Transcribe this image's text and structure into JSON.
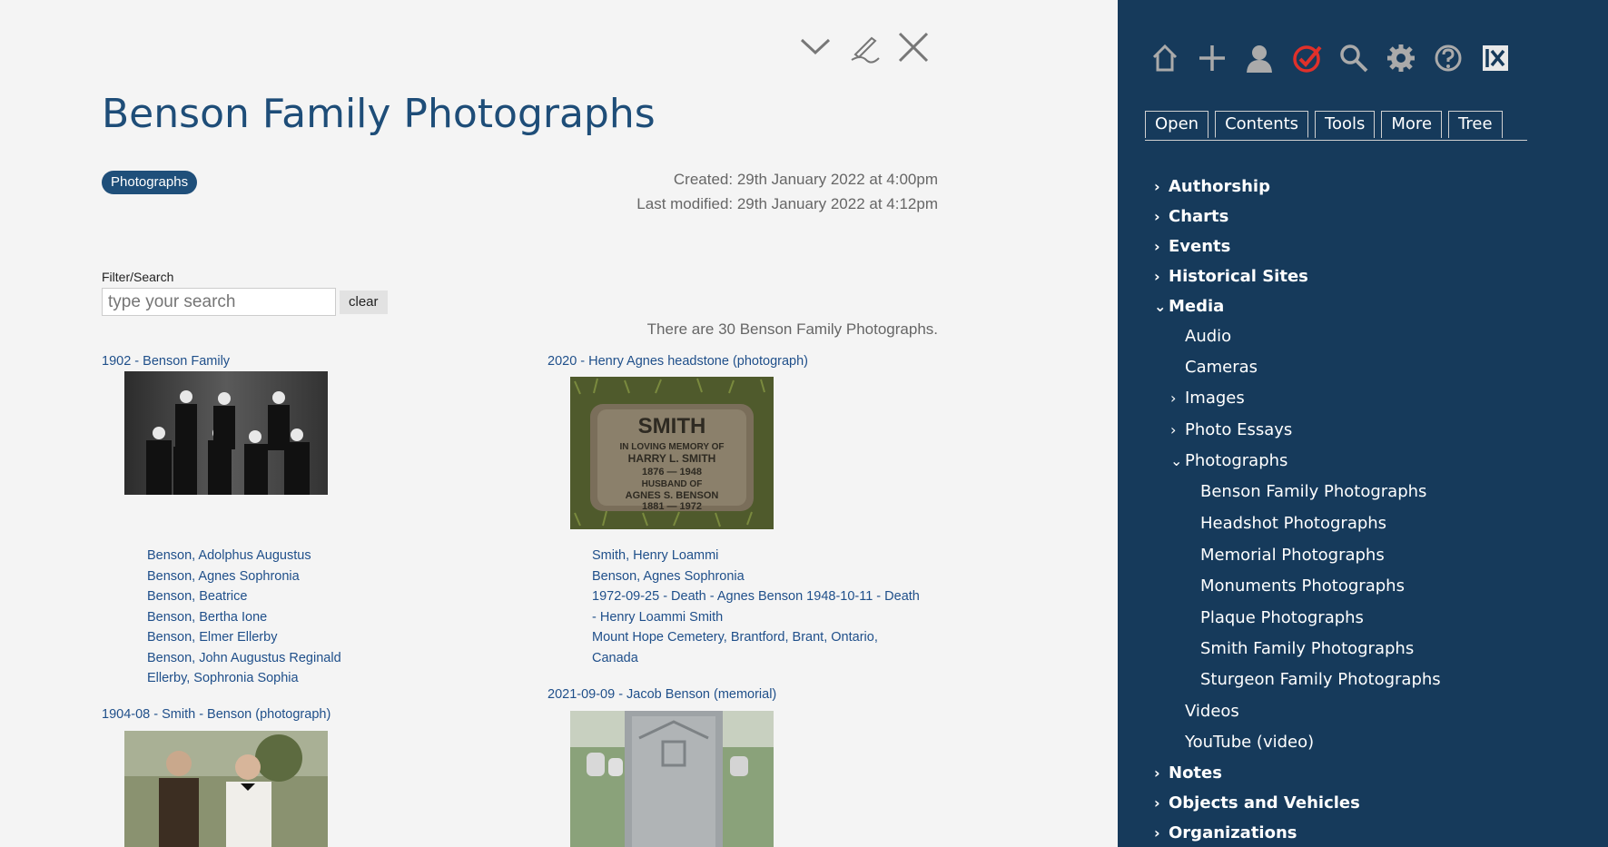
{
  "header": {
    "title": "Benson Family Photographs",
    "tag": "Photographs",
    "created": "Created: 29th January 2022 at 4:00pm",
    "modified": "Last modified: 29th January 2022 at 4:12pm"
  },
  "filter": {
    "label": "Filter/Search",
    "placeholder": "type your search",
    "clear_label": "clear"
  },
  "count_text": "There are 30 Benson Family Photographs.",
  "entries": [
    {
      "title": "1902 - Benson Family",
      "people": [
        "Benson, Adolphus Augustus",
        "Benson, Agnes Sophronia",
        "Benson, Beatrice",
        "Benson, Bertha Ione",
        "Benson, Elmer Ellerby",
        "Benson, John Augustus Reginald",
        "Ellerby, Sophronia Sophia"
      ]
    },
    {
      "title": "2020 - Henry Agnes headstone (photograph)",
      "people": [
        "Smith, Henry Loammi",
        "Benson, Agnes Sophronia",
        "1972-09-25 - Death - Agnes Benson 1948-10-11 - Death",
        "- Henry Loammi Smith",
        "Mount Hope Cemetery, Brantford, Brant, Ontario,",
        "Canada"
      ],
      "headstone_text": [
        "SMITH",
        "IN LOVING MEMORY OF",
        "HARRY L. SMITH",
        "1876 — 1948",
        "HUSBAND OF",
        "AGNES S. BENSON",
        "1881 — 1972"
      ]
    },
    {
      "title": "1904-08 - Smith - Benson (photograph)"
    },
    {
      "title": "2021-09-09 - Jacob Benson (memorial)"
    }
  ],
  "sidebar": {
    "toolbar": [
      "home-icon",
      "plus-icon",
      "user-icon",
      "check-circle-icon",
      "search-icon",
      "gear-icon",
      "help-icon",
      "close-box-icon"
    ],
    "accent": "#e0302a",
    "tabs": [
      "Open",
      "Contents",
      "Tools",
      "More",
      "Tree"
    ],
    "active_tab": "Contents",
    "tree": [
      {
        "label": "Authorship",
        "chev": "›"
      },
      {
        "label": "Charts",
        "chev": "›"
      },
      {
        "label": "Events",
        "chev": "›"
      },
      {
        "label": "Historical Sites",
        "chev": "›"
      },
      {
        "label": "Media",
        "chev": "⌄"
      },
      {
        "label": "Audio",
        "chev": ""
      },
      {
        "label": "Cameras",
        "chev": ""
      },
      {
        "label": "Images",
        "chev": "›"
      },
      {
        "label": "Photo Essays",
        "chev": "›"
      },
      {
        "label": "Photographs",
        "chev": "⌄"
      },
      {
        "label": "Benson Family Photographs",
        "chev": ""
      },
      {
        "label": "Headshot Photographs",
        "chev": ""
      },
      {
        "label": "Memorial Photographs",
        "chev": ""
      },
      {
        "label": "Monuments Photographs",
        "chev": ""
      },
      {
        "label": "Plaque Photographs",
        "chev": ""
      },
      {
        "label": "Smith Family Photographs",
        "chev": ""
      },
      {
        "label": "Sturgeon Family Photographs",
        "chev": ""
      },
      {
        "label": "Videos",
        "chev": ""
      },
      {
        "label": "YouTube (video)",
        "chev": ""
      },
      {
        "label": "Notes",
        "chev": "›"
      },
      {
        "label": "Objects and Vehicles",
        "chev": "›"
      },
      {
        "label": "Organizations",
        "chev": "›"
      }
    ]
  }
}
